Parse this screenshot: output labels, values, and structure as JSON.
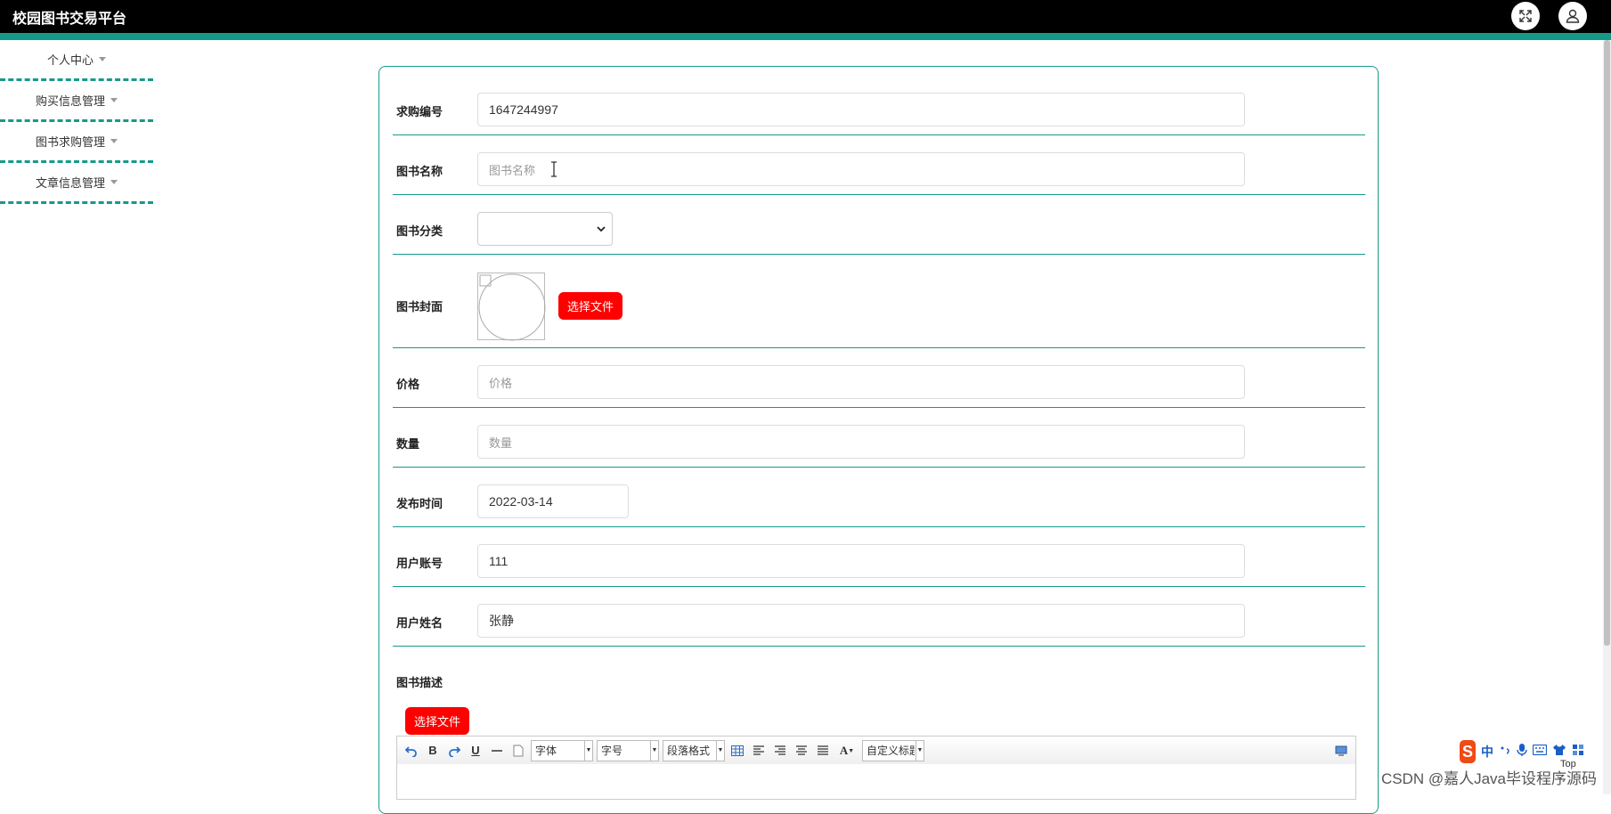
{
  "header": {
    "title": "校园图书交易平台",
    "bg_color": "#000000",
    "accent_color": "#159a8a"
  },
  "sidebar": {
    "items": [
      {
        "label": "个人中心"
      },
      {
        "label": "购买信息管理"
      },
      {
        "label": "图书求购管理"
      },
      {
        "label": "文章信息管理"
      }
    ]
  },
  "form": {
    "purchase_no": {
      "label": "求购编号",
      "value": "1647244997"
    },
    "book_name": {
      "label": "图书名称",
      "placeholder": "图书名称"
    },
    "book_category": {
      "label": "图书分类",
      "value": ""
    },
    "book_cover": {
      "label": "图书封面",
      "button": "选择文件"
    },
    "price": {
      "label": "价格",
      "placeholder": "价格"
    },
    "quantity": {
      "label": "数量",
      "placeholder": "数量"
    },
    "publish_time": {
      "label": "发布时间",
      "value": "2022-03-14"
    },
    "user_account": {
      "label": "用户账号",
      "value": "111"
    },
    "user_name": {
      "label": "用户姓名",
      "value": "张静"
    },
    "book_desc": {
      "label": "图书描述",
      "button": "选择文件"
    }
  },
  "editor_toolbar": {
    "font_family": "字体",
    "font_size": "字号",
    "paragraph": "段落格式",
    "custom_title": "自定义标题"
  },
  "accent_button_color": "#ff0000",
  "ime": {
    "s": "S",
    "zh": "中"
  },
  "watermark": "CSDN @嘉人Java毕设程序源码",
  "top_label": "Top"
}
